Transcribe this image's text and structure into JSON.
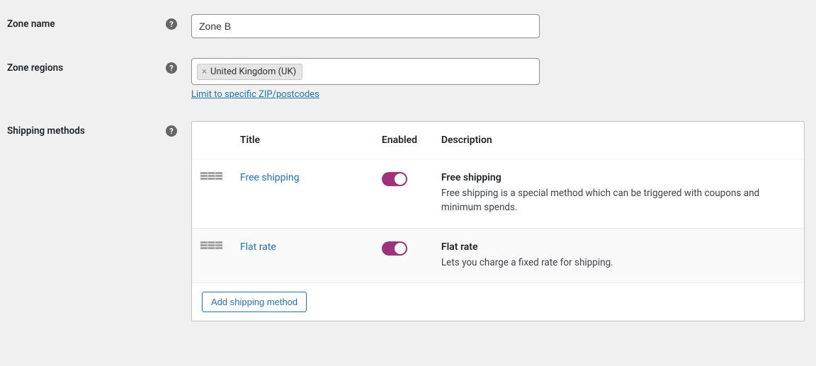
{
  "fields": {
    "zone_name": {
      "label": "Zone name",
      "value": "Zone B"
    },
    "zone_regions": {
      "label": "Zone regions",
      "tags": [
        {
          "label": "United Kingdom (UK)"
        }
      ],
      "limit_link": "Limit to specific ZIP/postcodes"
    },
    "shipping_methods": {
      "label": "Shipping methods",
      "columns": {
        "title": "Title",
        "enabled": "Enabled",
        "description": "Description"
      },
      "rows": [
        {
          "title": "Free shipping",
          "enabled": true,
          "desc_title": "Free shipping",
          "desc_text": "Free shipping is a special method which can be triggered with coupons and minimum spends."
        },
        {
          "title": "Flat rate",
          "enabled": true,
          "desc_title": "Flat rate",
          "desc_text": "Lets you charge a fixed rate for shipping."
        }
      ],
      "add_button": "Add shipping method"
    }
  }
}
